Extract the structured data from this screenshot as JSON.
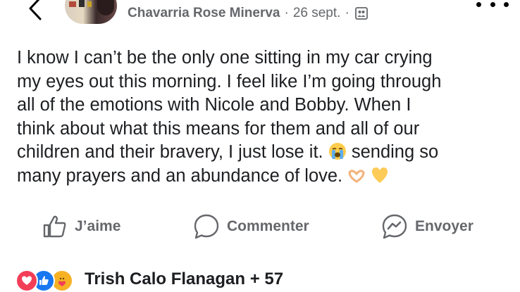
{
  "header": {
    "author": "Chavarria Rose Minerva",
    "separator": "·",
    "date": "26 sept.",
    "separator2": "·"
  },
  "post": {
    "lines": [
      "I know I can’t be the only one sitting in my car crying",
      "my eyes out this morning. I feel like I’m going through",
      "all of the emotions with Nicole and Bobby. When I",
      "think about what this means for them and all of our",
      "children and their bravery, I just lose it.",
      "sending so",
      "many prayers and an abundance of love."
    ]
  },
  "actions": {
    "like": "J’aime",
    "comment": "Commenter",
    "send": "Envoyer"
  },
  "reactions": {
    "summary": "Trish Calo Flanagan + 57",
    "types": [
      "love",
      "like",
      "care"
    ]
  },
  "colors": {
    "secondary_text": "#65676b",
    "love": "#f33e58",
    "like": "#1877f2",
    "care": "#f7b125"
  }
}
